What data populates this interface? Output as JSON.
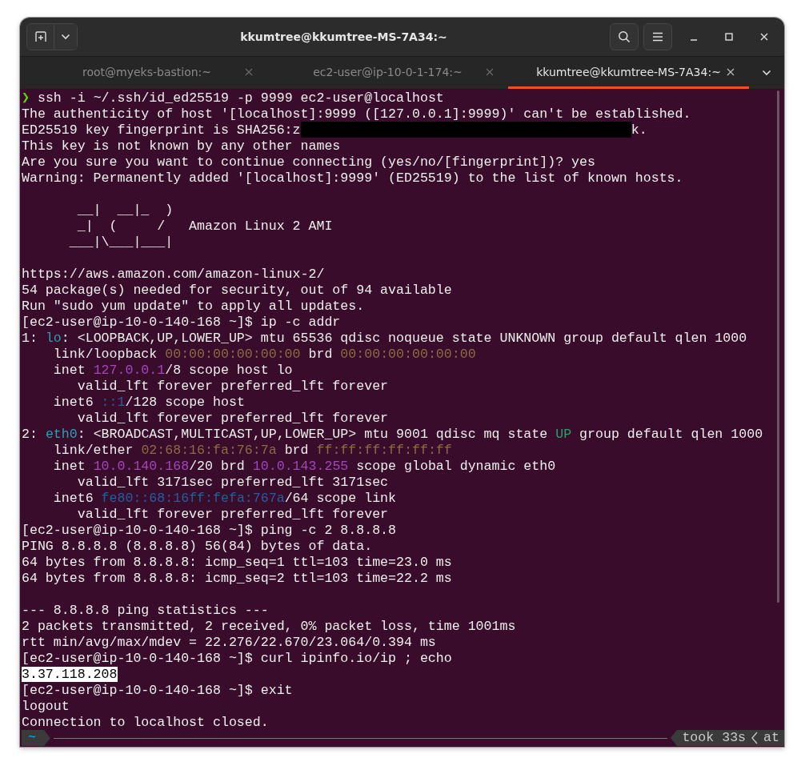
{
  "window": {
    "title": "kkumtree@kkumtree-MS-7A34:~"
  },
  "tabs": [
    {
      "label": "root@myeks-bastion:~",
      "selected": false
    },
    {
      "label": "ec2-user@ip-10-0-1-174:~",
      "selected": false
    },
    {
      "label": "kkumtree@kkumtree-MS-7A34:~",
      "selected": true
    }
  ],
  "terminal": {
    "lines": [
      {
        "segments": [
          {
            "kind": "arrow",
            "text": "❯"
          },
          {
            "kind": "plain",
            "text": " ssh -i ~/.ssh/id_ed25519 -p 9999 ec2-user@localhost"
          }
        ]
      },
      {
        "segments": [
          {
            "kind": "plain",
            "text": "The authenticity of host '[localhost]:9999 ([127.0.0.1]:9999)' can't be established."
          }
        ]
      },
      {
        "segments": [
          {
            "kind": "plain",
            "text": "ED25519 key fingerprint is SHA256:z"
          },
          {
            "kind": "redacted"
          },
          {
            "kind": "plain",
            "text": "k."
          }
        ]
      },
      {
        "segments": [
          {
            "kind": "plain",
            "text": "This key is not known by any other names"
          }
        ]
      },
      {
        "segments": [
          {
            "kind": "plain",
            "text": "Are you sure you want to continue connecting (yes/no/[fingerprint])? yes"
          }
        ]
      },
      {
        "segments": [
          {
            "kind": "plain",
            "text": "Warning: Permanently added '[localhost]:9999' (ED25519) to the list of known hosts."
          }
        ]
      },
      {
        "gap_before": true,
        "segments": [
          {
            "kind": "plain",
            "text": "       __|  __|_  )"
          }
        ]
      },
      {
        "segments": [
          {
            "kind": "plain",
            "text": "       _|  (     /   Amazon Linux 2 AMI"
          }
        ]
      },
      {
        "segments": [
          {
            "kind": "plain",
            "text": "      ___|\\___|___|"
          }
        ]
      },
      {
        "gap_before": true,
        "segments": [
          {
            "kind": "plain",
            "text": "https://aws.amazon.com/amazon-linux-2/"
          }
        ]
      },
      {
        "segments": [
          {
            "kind": "plain",
            "text": "54 package(s) needed for security, out of 94 available"
          }
        ]
      },
      {
        "segments": [
          {
            "kind": "plain",
            "text": "Run \"sudo yum update\" to apply all updates."
          }
        ]
      },
      {
        "segments": [
          {
            "kind": "plain",
            "text": "[ec2-user@ip-10-0-140-168 ~]$ ip -c addr"
          }
        ]
      },
      {
        "segments": [
          {
            "kind": "plain",
            "text": "1: "
          },
          {
            "kind": "iface",
            "text": "lo"
          },
          {
            "kind": "plain",
            "text": ": <LOOPBACK,UP,LOWER_UP> mtu 65536 qdisc noqueue state UNKNOWN group default qlen 1000"
          }
        ]
      },
      {
        "segments": [
          {
            "kind": "plain",
            "text": "    link/loopback "
          },
          {
            "kind": "mac",
            "text": "00:00:00:00:00:00"
          },
          {
            "kind": "plain",
            "text": " brd "
          },
          {
            "kind": "mac",
            "text": "00:00:00:00:00:00"
          }
        ]
      },
      {
        "segments": [
          {
            "kind": "plain",
            "text": "    inet "
          },
          {
            "kind": "ipv4",
            "text": "127.0.0.1"
          },
          {
            "kind": "plain",
            "text": "/8 scope host lo"
          }
        ]
      },
      {
        "segments": [
          {
            "kind": "plain",
            "text": "       valid_lft forever preferred_lft forever"
          }
        ]
      },
      {
        "segments": [
          {
            "kind": "plain",
            "text": "    inet6 "
          },
          {
            "kind": "ipv6",
            "text": "::1"
          },
          {
            "kind": "plain",
            "text": "/128 scope host"
          }
        ]
      },
      {
        "segments": [
          {
            "kind": "plain",
            "text": "       valid_lft forever preferred_lft forever"
          }
        ]
      },
      {
        "segments": [
          {
            "kind": "plain",
            "text": "2: "
          },
          {
            "kind": "iface",
            "text": "eth0"
          },
          {
            "kind": "plain",
            "text": ": <BROADCAST,MULTICAST,UP,LOWER_UP> mtu 9001 qdisc mq state "
          },
          {
            "kind": "state",
            "text": "UP"
          },
          {
            "kind": "plain",
            "text": " group default qlen 1000"
          }
        ]
      },
      {
        "segments": [
          {
            "kind": "plain",
            "text": "    link/ether "
          },
          {
            "kind": "mac",
            "text": "02:68:16:fa:76:7a"
          },
          {
            "kind": "plain",
            "text": " brd "
          },
          {
            "kind": "mac",
            "text": "ff:ff:ff:ff:ff:ff"
          }
        ]
      },
      {
        "segments": [
          {
            "kind": "plain",
            "text": "    inet "
          },
          {
            "kind": "ipv4",
            "text": "10.0.140.168"
          },
          {
            "kind": "plain",
            "text": "/20 brd "
          },
          {
            "kind": "ipv4",
            "text": "10.0.143.255"
          },
          {
            "kind": "plain",
            "text": " scope global dynamic eth0"
          }
        ]
      },
      {
        "segments": [
          {
            "kind": "plain",
            "text": "       valid_lft 3171sec preferred_lft 3171sec"
          }
        ]
      },
      {
        "segments": [
          {
            "kind": "plain",
            "text": "    inet6 "
          },
          {
            "kind": "ipv6",
            "text": "fe80::68:16ff:fefa:767a"
          },
          {
            "kind": "plain",
            "text": "/64 scope link"
          }
        ]
      },
      {
        "segments": [
          {
            "kind": "plain",
            "text": "       valid_lft forever preferred_lft forever"
          }
        ]
      },
      {
        "segments": [
          {
            "kind": "plain",
            "text": "[ec2-user@ip-10-0-140-168 ~]$ ping -c 2 8.8.8.8"
          }
        ]
      },
      {
        "segments": [
          {
            "kind": "plain",
            "text": "PING 8.8.8.8 (8.8.8.8) 56(84) bytes of data."
          }
        ]
      },
      {
        "segments": [
          {
            "kind": "plain",
            "text": "64 bytes from 8.8.8.8: icmp_seq=1 ttl=103 time=23.0 ms"
          }
        ]
      },
      {
        "segments": [
          {
            "kind": "plain",
            "text": "64 bytes from 8.8.8.8: icmp_seq=2 ttl=103 time=22.2 ms"
          }
        ]
      },
      {
        "gap_before": true,
        "segments": [
          {
            "kind": "plain",
            "text": "--- 8.8.8.8 ping statistics ---"
          }
        ]
      },
      {
        "segments": [
          {
            "kind": "plain",
            "text": "2 packets transmitted, 2 received, 0% packet loss, time 1001ms"
          }
        ]
      },
      {
        "segments": [
          {
            "kind": "plain",
            "text": "rtt min/avg/max/mdev = 22.276/22.670/23.064/0.394 ms"
          }
        ]
      },
      {
        "segments": [
          {
            "kind": "plain",
            "text": "[ec2-user@ip-10-0-140-168 ~]$ curl ipinfo.io/ip ; echo"
          }
        ]
      },
      {
        "segments": [
          {
            "kind": "highlight",
            "text": "3.37.118.208"
          }
        ]
      },
      {
        "segments": [
          {
            "kind": "plain",
            "text": "[ec2-user@ip-10-0-140-168 ~]$ exit"
          }
        ]
      },
      {
        "segments": [
          {
            "kind": "plain",
            "text": "logout"
          }
        ]
      },
      {
        "segments": [
          {
            "kind": "plain",
            "text": "Connection to localhost closed."
          }
        ]
      }
    ],
    "prompt": {
      "directory": "~",
      "duration": "took 33s",
      "suffix": "at"
    }
  }
}
